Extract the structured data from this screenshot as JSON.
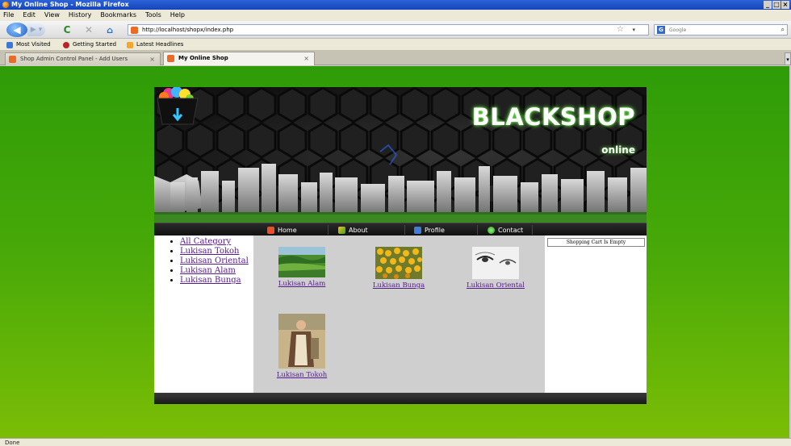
{
  "window": {
    "title": "My Online Shop - Mozilla Firefox",
    "controls": [
      "_",
      "□",
      "×"
    ]
  },
  "menubar": [
    "File",
    "Edit",
    "View",
    "History",
    "Bookmarks",
    "Tools",
    "Help"
  ],
  "navbar": {
    "url": "http://localhost/shopx/index.php",
    "search_placeholder": "Google",
    "search_engine_letter": "G"
  },
  "bookmarks": [
    "Most Visited",
    "Getting Started",
    "Latest Headlines"
  ],
  "tabs": [
    {
      "label": "Shop Admin Control Panel - Add Users",
      "active": false
    },
    {
      "label": "My Online Shop",
      "active": true
    }
  ],
  "status": "Done",
  "site": {
    "brand": "BLACKSHOP",
    "brand_sub": "online",
    "nav": [
      "Home",
      "About",
      "Profile",
      "Contact"
    ],
    "categories": [
      "All Category",
      "Lukisan Tokoh",
      "Lukisan Oriental",
      "Lukisan Alam",
      "Lukisan Bunga"
    ],
    "products": [
      "Lukisan Alam",
      "Lukisan Bunga",
      "Lukisan Oriental",
      "Lukisan Tokoh"
    ],
    "cart_status": "Shopping Cart Is Empty"
  },
  "colors": {
    "page_bg_top": "#2e9c08",
    "page_bg_bottom": "#7bbd06",
    "link": "#551a8b",
    "glow": "#7bff5a"
  }
}
